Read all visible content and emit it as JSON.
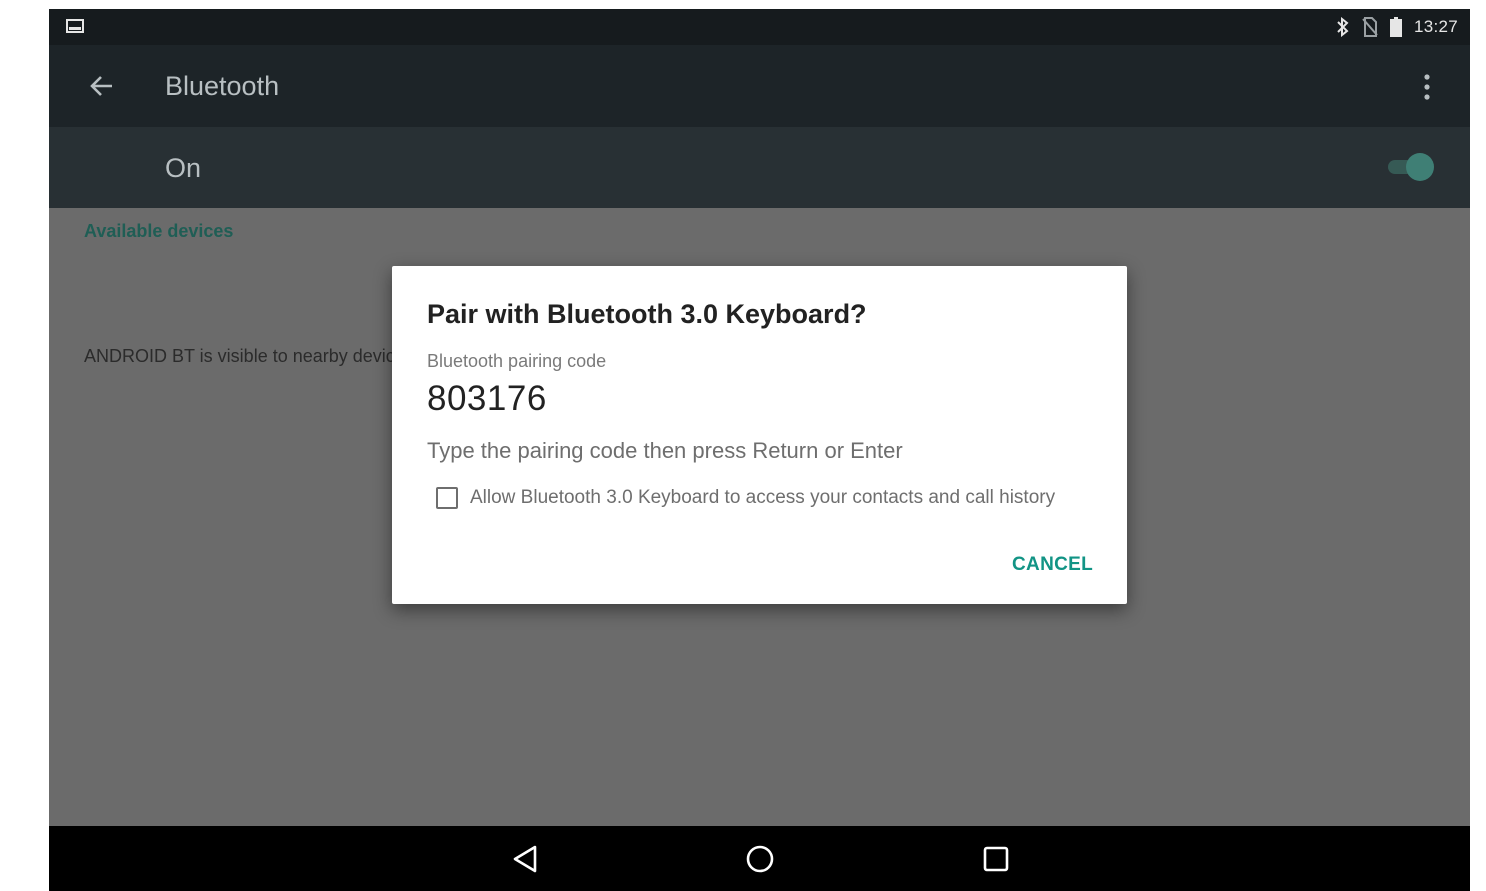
{
  "status_bar": {
    "time": "13:27"
  },
  "app_bar": {
    "title": "Bluetooth"
  },
  "toggle_row": {
    "label": "On",
    "enabled": true
  },
  "list": {
    "section_header": "Available devices",
    "visibility_text": "ANDROID BT is visible to nearby devices while Bluetooth settings is open."
  },
  "dialog": {
    "title": "Pair with Bluetooth 3.0 Keyboard?",
    "code_label": "Bluetooth pairing code",
    "code": "803176",
    "instruction": "Type the pairing code then press Return or Enter",
    "checkbox_label": "Allow Bluetooth 3.0 Keyboard to access your contacts and call history",
    "checkbox_checked": false,
    "cancel_label": "CANCEL"
  },
  "colors": {
    "accent": "#129485",
    "section_header": "#1f5e55",
    "toggle_thumb": "#3f7f75"
  }
}
